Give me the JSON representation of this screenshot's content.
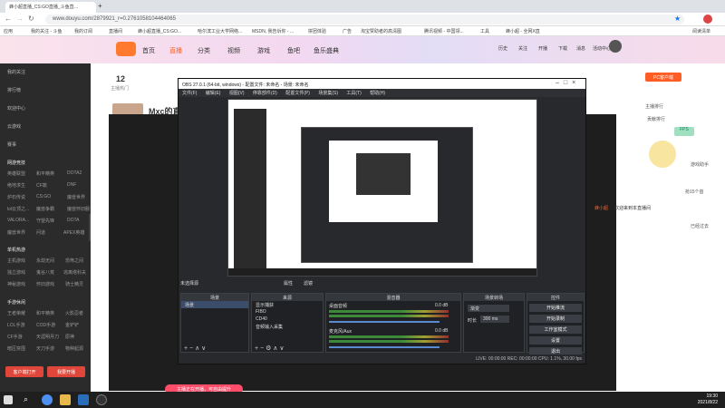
{
  "browser": {
    "tabs": [
      {
        "title": "蜂小超直播_CS:GO直播_斗鱼直…",
        "active": true
      }
    ],
    "url": "www.douyu.com/2879921_r=0.2761058104464065",
    "bookmarks": [
      "应用",
      "我的关注 - 斗鱼",
      "我的订阅",
      "直播间",
      "蜂小超直播_CS:GO...",
      "哈尔滨工业大学网络...",
      "MSDN, 我告诉你 - ...",
      "拼团体验",
      "广告",
      "淘宝赞助者的高清图",
      "腾讯视频 - 中国领...",
      "工具",
      "蜂小超 - 全网X直",
      "阅读清单"
    ]
  },
  "site": {
    "nav": [
      "首页",
      "直播",
      "分类",
      "视频",
      "游戏",
      "鱼吧",
      "鱼乐盛典"
    ],
    "nav_active": "直播",
    "topicons": [
      "历史",
      "关注",
      "开播",
      "下载",
      "消息",
      "活动中心"
    ],
    "sidebar": {
      "items": [
        "我的关注",
        "排行榜",
        "欢迎中心",
        "云游戏",
        "赛事"
      ],
      "sections": [
        {
          "title": "网游竞技",
          "cats": [
            "英雄联盟",
            "和平精英",
            "DOTA2",
            "绝地求生",
            "CF端",
            "DNF",
            "炉石传说",
            "CS:GO",
            "魔兽世界",
            "lol云顶之...",
            "魔兽争霸",
            "魔兽怀旧服",
            "VALORA...",
            "守望先锋",
            "DOTA",
            "魔兽世界",
            "问道",
            "APEX英雄"
          ]
        },
        {
          "title": "单机热游",
          "cats": [
            "主机游戏",
            "永劫无间",
            "恐怖之间",
            "独立游戏",
            "鬼谷八荒",
            "逃离塔科夫",
            "神秘游戏",
            "怀旧游戏",
            "骑士精灵"
          ]
        },
        {
          "title": "手游休闲",
          "cats": [
            "王者荣耀",
            "和平精英",
            "火影忍者",
            "LOL手游",
            "COD手游",
            "金铲铲",
            "CF手游",
            "天涯明月刀",
            "原神",
            "暗区突围",
            "天刀手游",
            "物种起源"
          ]
        }
      ],
      "btn_left": "客户端打开",
      "btn_right": "我要开播"
    },
    "room": {
      "followers": "12",
      "followers_label": "主播热门",
      "rank_label": "主播排行",
      "streamer": "Mxc的直",
      "badge": "斗鱼",
      "right_user": "蜂小超",
      "welcome": "欢迎来到本直播间",
      "download": "PC客户端",
      "rank": "主播排行",
      "contrib": "贡献排行",
      "gift": "贡献",
      "fps": "FPS",
      "help": "游戏助手",
      "side_btn": "抢15个首",
      "side2": "已经过去"
    },
    "toast": "主播正在开播，可自由提升"
  },
  "obs": {
    "title": "OBS 27.0.1 (64-bit, windows) - 配置文件: 未命名 - 场景: 未命名",
    "menu": [
      "文件(F)",
      "编辑(E)",
      "视图(V)",
      "停靠部件(D)",
      "配置文件(P)",
      "场景集(S)",
      "工具(T)",
      "帮助(H)"
    ],
    "no_source": "未选择源",
    "props": "属性",
    "filters": "滤镜",
    "docks": {
      "scenes": "场景",
      "sources": "来源",
      "mixer": "混音器",
      "transitions": "场景转场",
      "controls": "控件"
    },
    "scene_items": [
      "场景"
    ],
    "source_items": [
      "显示捕获",
      "FIBO",
      "CD40",
      "音频输入采集"
    ],
    "mixer_items": [
      {
        "name": "桌面音频",
        "db": "0.0 dB"
      },
      {
        "name": "麦克风/Aux",
        "db": "0.0 dB"
      }
    ],
    "transition": {
      "type": "渐变",
      "duration_label": "时长",
      "duration": "300 ms"
    },
    "controls": [
      "开始推流",
      "开始录制",
      "工作室模式",
      "设置",
      "退出"
    ],
    "status": "LIVE: 00:00:00   REC: 00:00:00   CPU: 1.1%, 30.00 fps"
  },
  "taskbar": {
    "time": "19:30",
    "date": "2021/8/22"
  }
}
